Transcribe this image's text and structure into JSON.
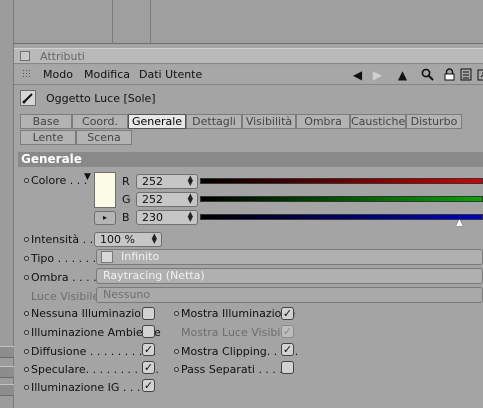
{
  "panel": {
    "title": "Attributi"
  },
  "menu": {
    "items": [
      "Modo",
      "Modifica",
      "Dati Utente"
    ]
  },
  "object": {
    "title": "Oggetto Luce [Sole]"
  },
  "tabs": {
    "row1": [
      "Base",
      "Coord.",
      "Generale",
      "Dettagli",
      "Visibilità",
      "Ombra",
      "Caustiche",
      "Disturbo"
    ],
    "row2": [
      "Lente",
      "Scena"
    ],
    "active": "Generale"
  },
  "section": {
    "title": "Generale"
  },
  "color": {
    "label": "Colore . . .",
    "swatch": "#fcfce6",
    "r": {
      "label": "R",
      "value": "252"
    },
    "g": {
      "label": "G",
      "value": "252"
    },
    "b": {
      "label": "B",
      "value": "230"
    }
  },
  "intensity": {
    "label": "Intensità . .",
    "value": "100 %"
  },
  "type": {
    "label": "Tipo . . . . . . .",
    "value": "Infinito"
  },
  "shadow": {
    "label": "Ombra . . . . .",
    "value": "Raytracing (Netta)"
  },
  "visible_light": {
    "label": "Luce Visibile",
    "value": "Nessuno"
  },
  "options_left": [
    {
      "label": "Nessuna Illuminazione",
      "checked": false
    },
    {
      "label": "Illuminazione Ambiente",
      "checked": false
    },
    {
      "label": "Diffusione . . . . . . . . . .",
      "checked": true
    },
    {
      "label": "Speculare. . . . . . . . . . .",
      "checked": true
    },
    {
      "label": "Illuminazione IG . . . . .",
      "checked": true
    }
  ],
  "options_right": [
    {
      "label": "Mostra Illuminazione",
      "checked": true
    },
    {
      "label": "Mostra Luce Visibile",
      "checked": true,
      "disabled": true
    },
    {
      "label": "Mostra Clipping. . . . .",
      "checked": true
    },
    {
      "label": "Pass Separati . . . . .",
      "checked": false
    }
  ],
  "colors": {
    "red": "#d10000",
    "green": "#00a800",
    "blue": "#0000c8",
    "section": "#898989"
  },
  "icons": [
    "arrow-left-icon",
    "arrow-right-icon",
    "arrow-up-icon",
    "search-icon",
    "lock-icon",
    "settings-icon",
    "expand-icon"
  ]
}
